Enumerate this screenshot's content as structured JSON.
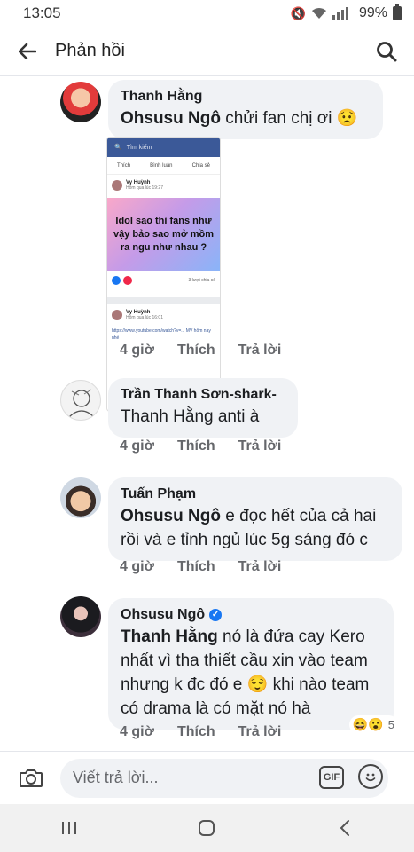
{
  "status_bar": {
    "time": "13:05",
    "battery": "99%"
  },
  "header": {
    "title": "Phản hồi"
  },
  "comments": [
    {
      "author": "Thanh Hằng",
      "mention": "Ohsusu Ngô",
      "text": " chửi fan chị ơi 😟",
      "time": "4 giờ",
      "like": "Thích",
      "reply": "Trả lời",
      "attachment": {
        "search_label": "Tìm kiếm",
        "actions": [
          "Thích",
          "Bình luận",
          "Chia sẻ"
        ],
        "post_author": "Vy Huỳnh",
        "post_time": "Hôm qua lúc 19:27",
        "banner_text": "Idol sao thì fans như vậy bảo sao mở mồm ra ngu như nhau ?",
        "reaction_label": "3 lượt chia sẻ",
        "post2_author": "Vy Huỳnh",
        "post2_time": "Hôm qua lúc 16:01",
        "link_text": "https://www.youtube.com/watch?v=... MV hôm nay nhé"
      }
    },
    {
      "author": "Trần Thanh Sơn-shark-",
      "text": "Thanh Hằng anti à",
      "time": "4 giờ",
      "like": "Thích",
      "reply": "Trả lời"
    },
    {
      "author": "Tuấn Phạm",
      "mention": "Ohsusu Ngô",
      "text": " e đọc hết của cả hai rồi và e tỉnh ngủ lúc 5g sáng đó c",
      "time": "4 giờ",
      "like": "Thích",
      "reply": "Trả lời"
    },
    {
      "author": "Ohsusu Ngô",
      "mention": "Thanh Hằng",
      "text": " nó là đứa cay Kero nhất vì tha thiết cầu xin vào team nhưng k đc đó e 😌 khi nào team có drama là có mặt nó hà",
      "time": "4 giờ",
      "like": "Thích",
      "reply": "Trả lời",
      "reaction_count": "5",
      "reaction_emojis": "😆😮"
    }
  ],
  "compose": {
    "placeholder": "Viết trả lời...",
    "gif_label": "GIF"
  },
  "colors": {
    "bubble": "#f0f2f5",
    "secondary_text": "#65676b",
    "verified": "#1877f2"
  }
}
